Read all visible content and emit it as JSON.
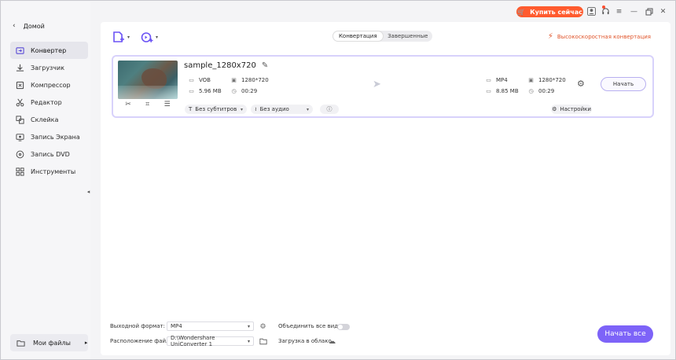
{
  "sidebar": {
    "home_label": "Домой",
    "items": [
      {
        "label": "Конвертер",
        "icon": "converter-icon",
        "active": true
      },
      {
        "label": "Загрузчик",
        "icon": "downloader-icon",
        "active": false
      },
      {
        "label": "Компрессор",
        "icon": "compressor-icon",
        "active": false
      },
      {
        "label": "Редактор",
        "icon": "editor-icon",
        "active": false
      },
      {
        "label": "Склейка",
        "icon": "merge-icon",
        "active": false
      },
      {
        "label": "Запись Экрана",
        "icon": "screen-record-icon",
        "active": false
      },
      {
        "label": "Запись DVD",
        "icon": "dvd-icon",
        "active": false
      },
      {
        "label": "Инструменты",
        "icon": "tools-icon",
        "active": false
      }
    ],
    "my_files_label": "Мои файлы"
  },
  "titlebar": {
    "buy_label": "Купить сейчас",
    "accent": "#ff5b2e"
  },
  "toolbar": {
    "tabs": [
      "Конвертация",
      "Завершенные"
    ],
    "active_tab": 0,
    "fast_conversion_label": "Высокоскоростная конвертация"
  },
  "file": {
    "name": "sample_1280x720",
    "source": {
      "format": "VOB",
      "resolution": "1280*720",
      "size": "5.96 MB",
      "duration": "00:29"
    },
    "target": {
      "format": "MP4",
      "resolution": "1280*720",
      "size": "8.85 MB",
      "duration": "00:29"
    },
    "start_label": "Начать",
    "subtitles_label": "Без субтитров",
    "audio_label": "Без аудио",
    "settings_label": "Настройки"
  },
  "bottom": {
    "output_format_label": "Выходной формат:",
    "output_format_value": "MP4",
    "merge_label": "Объединить все видео",
    "file_location_label": "Расположение файла:",
    "file_location_value": "D:\\Wondershare UniConverter 1",
    "cloud_label": "Загрузка в облако",
    "start_all_label": "Начать все",
    "accent": "#7d63f8"
  }
}
